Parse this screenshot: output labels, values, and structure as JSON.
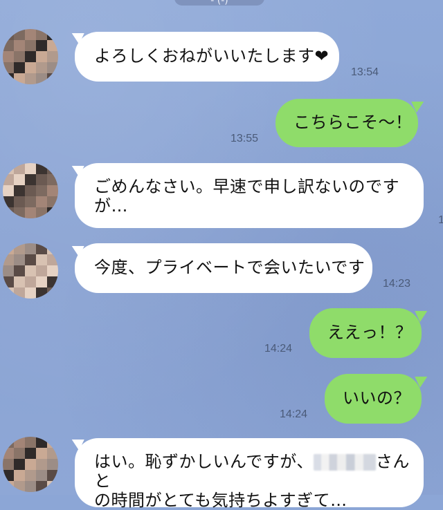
{
  "header": {
    "title_fragment": "- (-)"
  },
  "messages": [
    {
      "id": "m1",
      "side": "in",
      "text": "よろしくおねがいいたします",
      "heart": "❤",
      "time": "13:54"
    },
    {
      "id": "m2",
      "side": "out",
      "text": "こちらこそ〜！",
      "time": "13:55"
    },
    {
      "id": "m3",
      "side": "in",
      "line1": "ごめんなさい。早速で申し訳ないのです",
      "line2": "が…",
      "time_fragment": "1"
    },
    {
      "id": "m4",
      "side": "in",
      "text": "今度、プライベートで会いたいです",
      "time": "14:23"
    },
    {
      "id": "m5",
      "side": "out",
      "text": "ええっ！？",
      "time": "14:24"
    },
    {
      "id": "m6",
      "side": "out",
      "text": "いいの？",
      "time": "14:24"
    },
    {
      "id": "m7",
      "side": "in",
      "line1_a": "はい。恥ずかしいんですが、",
      "line1_b": "さんと",
      "line2": "の時間がとても気持ちよすぎて…"
    }
  ],
  "colors": {
    "background": "#8ca6d6",
    "incoming_bubble": "#ffffff",
    "outgoing_bubble": "#8fdc6a",
    "timestamp": "#4a5a78"
  },
  "icons": {
    "heart": "heart-icon",
    "avatar": "pixelated-avatar"
  }
}
